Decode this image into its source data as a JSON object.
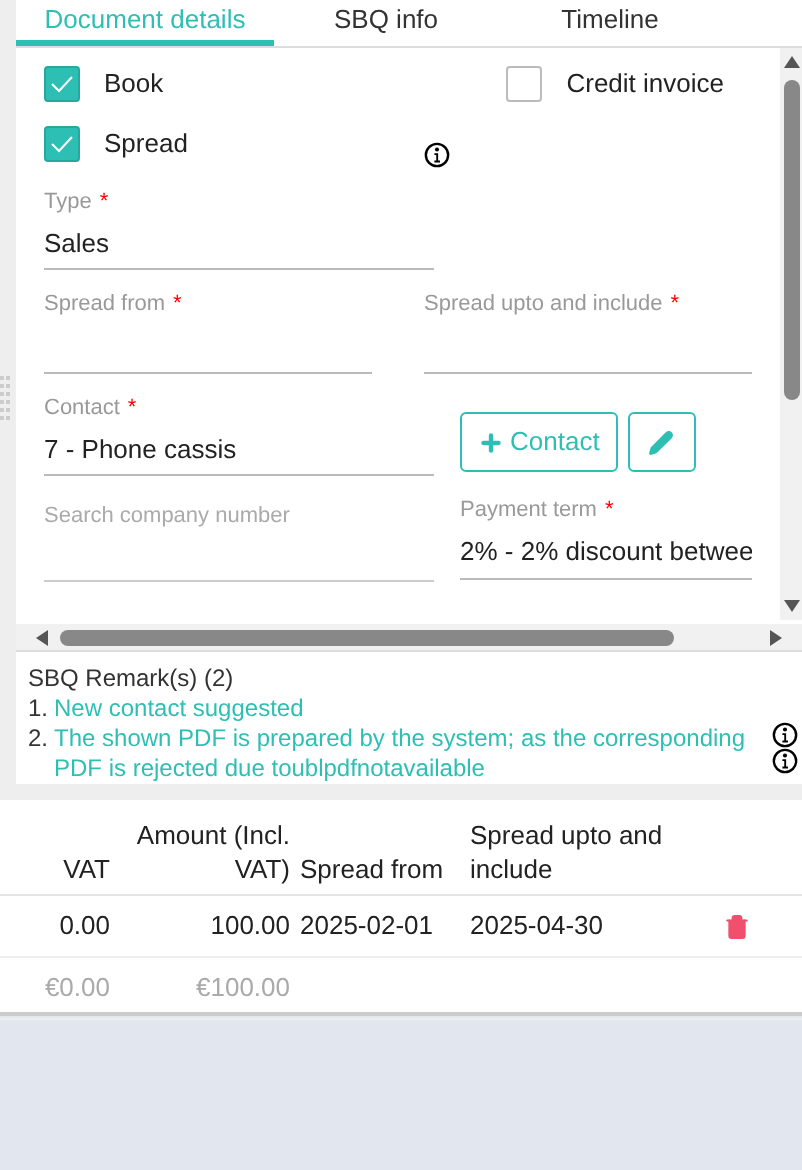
{
  "tabs": [
    {
      "label": "Document details",
      "selected": true
    },
    {
      "label": "SBQ info",
      "selected": false
    },
    {
      "label": "Timeline",
      "selected": false
    }
  ],
  "checkboxes": [
    {
      "label": "Book",
      "checked": true
    },
    {
      "label": "Credit invoice",
      "checked": false
    },
    {
      "label": "Spread",
      "checked": true
    }
  ],
  "type_field": {
    "label": "Type",
    "required_mark": "*",
    "value": "Sales"
  },
  "spread_from": {
    "label": "Spread from",
    "required_mark": "*"
  },
  "spread_upto": {
    "label": "Spread upto and include",
    "required_mark": "*"
  },
  "contact_field": {
    "label": "Contact",
    "required_mark": "*",
    "value": "7 - Phone cassis"
  },
  "add_contact_button": {
    "label": "Contact"
  },
  "company_search": {
    "placeholder": "Search company number"
  },
  "payment_term": {
    "label": "Payment term",
    "required_mark": "*",
    "value": "2% - 2% discount betwee"
  },
  "remarks": {
    "title": "SBQ Remark(s) (2)",
    "items": [
      {
        "number": "1.",
        "text": "New contact suggested"
      },
      {
        "number": "2.",
        "text": "The shown PDF is prepared by the system; as the corresponding PDF is rejected due toublpdfnotavailable"
      }
    ]
  },
  "table": {
    "columns": [
      "VAT",
      "Amount (Incl. VAT)",
      "Spread from",
      "Spread upto and include"
    ],
    "rows": [
      {
        "kind": "data",
        "cells": [
          "0.00",
          "100.00",
          "2025-02-01",
          "2025-04-30"
        ]
      },
      {
        "kind": "total",
        "cells": [
          "€0.00",
          "€100.00"
        ]
      }
    ]
  }
}
